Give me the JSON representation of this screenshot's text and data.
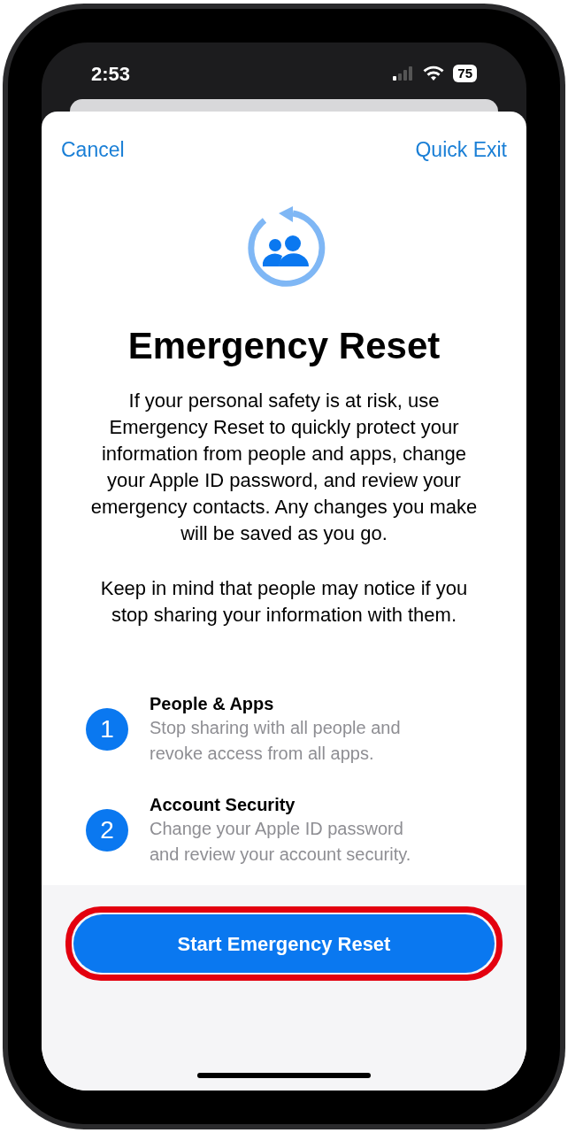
{
  "status_bar": {
    "time": "2:53",
    "battery": "75"
  },
  "nav": {
    "cancel": "Cancel",
    "quick_exit": "Quick Exit"
  },
  "title": "Emergency Reset",
  "paragraphs": [
    "If your personal safety is at risk, use Emergency Reset to quickly protect your information from people and apps, change your Apple ID password, and review your emergency contacts. Any changes you make will be saved as you go.",
    "Keep in mind that people may notice if you stop sharing your information with them."
  ],
  "steps": [
    {
      "number": "1",
      "title": "People & Apps",
      "description": "Stop sharing with all people and revoke access from all apps."
    },
    {
      "number": "2",
      "title": "Account Security",
      "description": "Change your Apple ID password and review your account security."
    }
  ],
  "primary_button": {
    "label": "Start Emergency Reset",
    "highlighted": true
  }
}
